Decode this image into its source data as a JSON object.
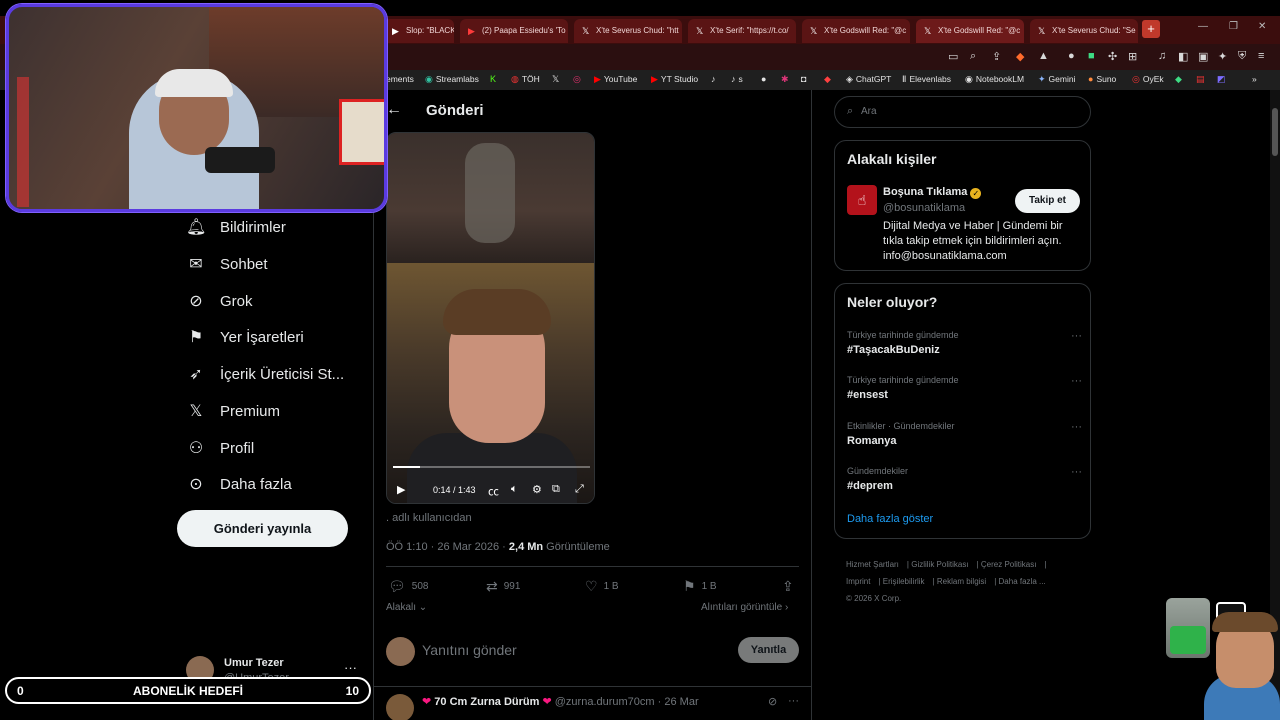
{
  "browser": {
    "tabs": [
      {
        "title": "Slop: \"BLACKS",
        "icon": "youtube-icon"
      },
      {
        "title": "(2) Paapa Essiedu's 'To",
        "icon": "youtube-icon"
      },
      {
        "title": "X'te Severus Chud: \"htt",
        "icon": "x-icon"
      },
      {
        "title": "X'te Serif: \"https://t.co/",
        "icon": "x-icon"
      },
      {
        "title": "X'te Godswill Red: \"@c",
        "icon": "x-icon"
      },
      {
        "title": "X'te Godswill Red: \"@c",
        "icon": "x-icon"
      },
      {
        "title": "X'te Severus Chud: \"Se",
        "icon": "x-icon"
      }
    ],
    "new_tab": "+",
    "bookmarks": [
      {
        "label": "ements",
        "icon": ""
      },
      {
        "label": "Streamlabs",
        "icon": "streamlabs-icon"
      },
      {
        "label": "",
        "icon": "kick-icon"
      },
      {
        "label": "TÖH",
        "icon": "toh-icon"
      },
      {
        "label": "",
        "icon": "x-icon"
      },
      {
        "label": "",
        "icon": "instagram-icon"
      },
      {
        "label": "YouTube",
        "icon": "youtube-icon"
      },
      {
        "label": "YT Studio",
        "icon": "yt-studio-icon"
      },
      {
        "label": "",
        "icon": "tiktok-icon"
      },
      {
        "label": "s",
        "icon": "tiktok-icon"
      },
      {
        "label": "ChatGPT",
        "icon": "chatgpt-icon"
      },
      {
        "label": "Elevenlabs",
        "icon": "elevenlabs-icon"
      },
      {
        "label": "NotebookLM",
        "icon": "notebooklm-icon"
      },
      {
        "label": "Gemini",
        "icon": "gemini-icon"
      },
      {
        "label": "Suno",
        "icon": "suno-icon"
      },
      {
        "label": "OyEk",
        "icon": "oyek-icon"
      }
    ]
  },
  "nav": {
    "items": [
      {
        "label": "Bildirimler",
        "icon": "bell-icon"
      },
      {
        "label": "Sohbet",
        "icon": "mail-icon"
      },
      {
        "label": "Grok",
        "icon": "grok-icon"
      },
      {
        "label": "Yer İşaretleri",
        "icon": "bookmark-icon"
      },
      {
        "label": "İçerik Üreticisi St...",
        "icon": "rocket-icon"
      },
      {
        "label": "Premium",
        "icon": "x-icon"
      },
      {
        "label": "Profil",
        "icon": "person-icon"
      },
      {
        "label": "Daha fazla",
        "icon": "more-circle-icon"
      }
    ],
    "post_button": "Gönderi yayınla",
    "account": {
      "name": "Umur Tezer",
      "handle": "@UmurTezer"
    }
  },
  "post": {
    "header_title": "Gönderi",
    "video": {
      "time": "0:14 / 1:43",
      "progress": 0.136
    },
    "author_text": ". adlı kullanıcıdan",
    "time": "ÖÖ 1:10 · 26 Mar 2026 · ",
    "views": "2,4 Mn",
    "views_label": " Görüntüleme",
    "stats": {
      "replies": "508",
      "reposts": "991",
      "likes": "1 B",
      "bookmarks": "1 B"
    },
    "relevant_label": "Alakalı",
    "quotes_label": "Alıntıları görüntüle",
    "reply_placeholder": "Yanıtını gönder",
    "reply_button": "Yanıtla",
    "next_reply": {
      "name": "70 Cm Zurna Dürüm",
      "handle": "@zurna.durum70cm",
      "date": "· 26 Mar"
    }
  },
  "sidebar": {
    "search_placeholder": "Ara",
    "relevant_people": {
      "title": "Alakalı kişiler",
      "name": "Boşuna Tıklama",
      "handle": "@bosunatiklama",
      "follow": "Takip et",
      "bio": "Dijital Medya ve Haber | Gündemi bir tıkla takip etmek için bildirimleri açın. info@bosunatiklama.com"
    },
    "trends": {
      "title": "Neler oluyor?",
      "items": [
        {
          "context": "Türkiye tarihinde gündemde",
          "name": "#TaşacakBuDeniz"
        },
        {
          "context": "Türkiye tarihinde gündemde",
          "name": "#ensest"
        },
        {
          "context": "Etkinlikler · Gündemdekiler",
          "name": "Romanya"
        },
        {
          "context": "Gündemdekiler",
          "name": "#deprem"
        }
      ],
      "show_more": "Daha fazla göster"
    },
    "footer": [
      "Hizmet Şartları",
      "Gizlilik Politikası",
      "Çerez Politikası",
      "Imprint",
      "Erişilebilirlik",
      "Reklam bilgisi",
      "Daha fazla ...",
      "© 2026 X Corp."
    ]
  },
  "overlay": {
    "goal_label": "ABONELİK HEDEFİ",
    "goal_current": "0",
    "goal_target": "10"
  },
  "colors": {
    "accent": "#1d9bf0",
    "tab_bg": "#5a1414",
    "cam_border": "#5a3be0"
  }
}
